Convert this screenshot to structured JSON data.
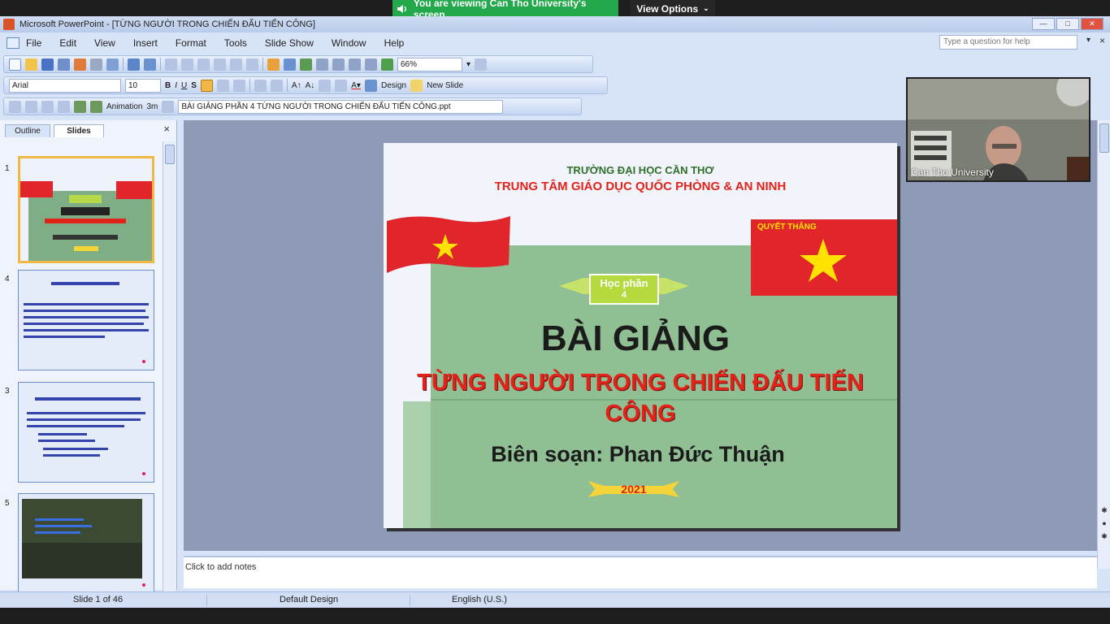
{
  "share_bar": {
    "message": "You are viewing Can Tho University's screen",
    "view_options": "View Options"
  },
  "window": {
    "title": "Microsoft PowerPoint - [TỪNG NGƯỜI TRONG CHIẾN ĐẤU TIẾN CÔNG]"
  },
  "menu": {
    "items": [
      "File",
      "Edit",
      "View",
      "Insert",
      "Format",
      "Tools",
      "Slide Show",
      "Window",
      "Help"
    ],
    "help_placeholder": "Type a question for help"
  },
  "toolbar": {
    "zoom": "66%",
    "font_name": "Arial",
    "font_size": "10",
    "design": "Design",
    "new_slide": "New Slide",
    "animation": "Animation",
    "show_time": "3m",
    "file_name": "BÀI GIẢNG PHẦN 4 TỪNG NGƯỜI TRONG CHIẾN ĐẤU TIẾN CÔNG.ppt"
  },
  "pane": {
    "tabs": [
      "Outline",
      "Slides"
    ]
  },
  "thumbnails": [
    {
      "number": "1"
    },
    {
      "number": "4"
    },
    {
      "number": "3"
    },
    {
      "number": "5"
    }
  ],
  "slide": {
    "school": "TRƯỜNG ĐẠI HỌC CẦN THƠ",
    "center": "TRUNG TÂM GIÁO DỤC QUỐC PHÒNG & AN NINH",
    "flag_caption": "QUYẾT THẮNG",
    "ribbon_line1": "Học phần",
    "ribbon_line2": "4",
    "heading": "BÀI GIẢNG",
    "subtitle": "TỪNG NGƯỜI TRONG CHIẾN ĐẤU TIẾN CÔNG",
    "author": "Biên soạn: Phan Đức Thuận",
    "year": "2021"
  },
  "notes_placeholder": "Click to add notes",
  "status": {
    "slide_counter": "Slide 1 of 46",
    "design": "Default Design",
    "language": "English (U.S.)"
  },
  "video": {
    "name": "Can Tho University"
  },
  "colors": {
    "banner_green": "#23a94b",
    "flag_red": "#e0262a",
    "star_yellow": "#ffe200",
    "slide_green": "#8fbf92",
    "title_red": "#e2231a"
  }
}
